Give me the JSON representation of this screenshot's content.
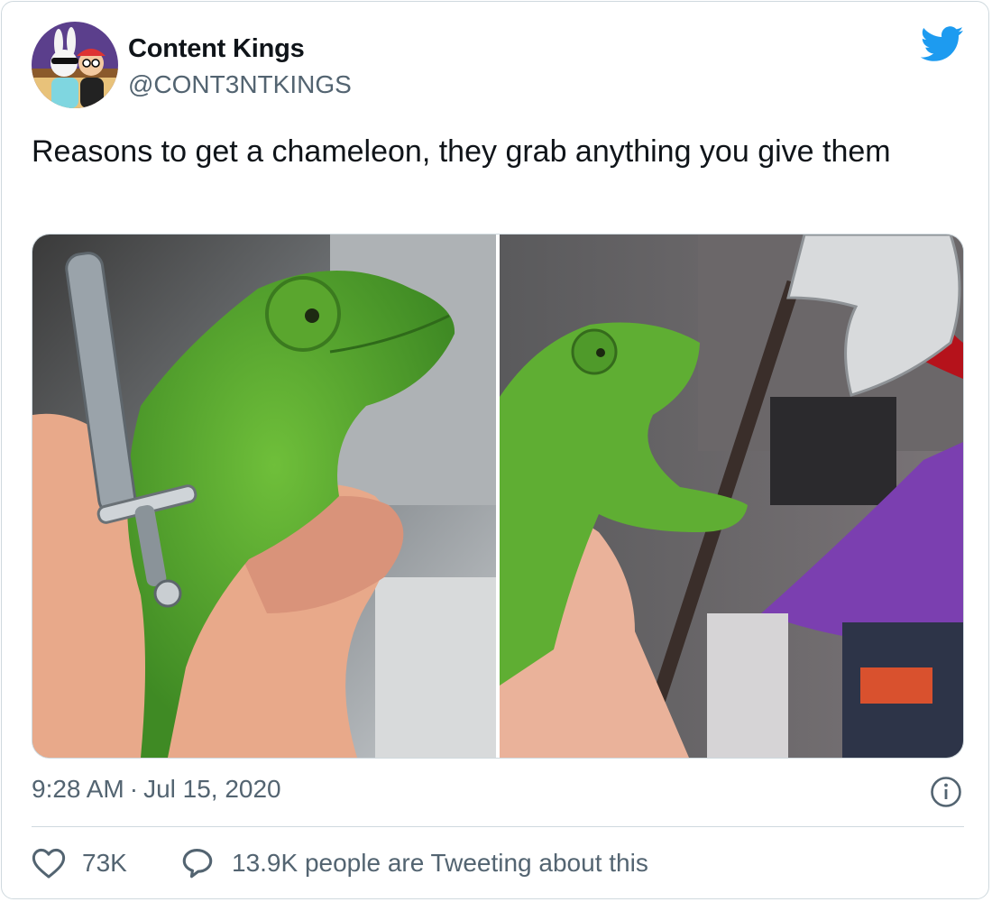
{
  "author": {
    "name": "Content Kings",
    "handle": "@CONT3NTKINGS",
    "avatar_icon": "cartoon-avatar"
  },
  "brand": {
    "icon": "twitter-bird-icon",
    "color": "#1d9bf0"
  },
  "tweet": {
    "text": "Reasons to get a chameleon, they grab anything you give them",
    "media": [
      {
        "name": "chameleon-holding-sword-photo"
      },
      {
        "name": "chameleon-holding-axe-photo"
      }
    ],
    "time": "9:28 AM",
    "separator": "·",
    "date": "Jul 15, 2020"
  },
  "actions": {
    "likes": "73K",
    "conversation": "13.9K people are Tweeting about this"
  },
  "colors": {
    "secondary_text": "#536471",
    "border": "#cfd9de",
    "text": "#0f1419"
  }
}
